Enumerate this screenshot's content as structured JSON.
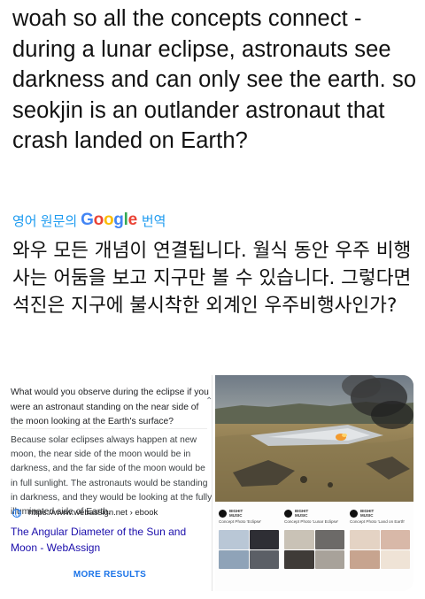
{
  "tweet": {
    "text": "woah so all the concepts connect - during a lunar eclipse, astronauts see darkness and can only see the earth. so seokjin is an outlander astronaut that crash landed on Earth?",
    "translate_prefix": "영어 원문의",
    "translate_google": "Google",
    "translate_suffix": "번역",
    "translated_text": "와우 모든 개념이 연결됩니다. 월식 동안 우주 비행사는 어둠을 보고 지구만 볼 수 있습니다. 그렇다면 석진은 지구에 불시착한 외계인 우주비행사인가?"
  },
  "search_card": {
    "question": "What would you observe during the eclipse if you were an astronaut standing on the near side of the moon looking at the Earth's surface?",
    "answer": "Because solar eclipses always happen at new moon, the near side of the moon would be in darkness, and the far side of the moon would be in full sunlight. The astronauts would be standing in darkness, and they would be looking at the fully illuminated side of Earth.",
    "source_url": "https://www.webassign.net › ebook",
    "source_title": "The Angular Diameter of the Sun and Moon - WebAssign",
    "more_results": "MORE RESULTS"
  },
  "mini_posts": [
    {
      "caption": "Concept Photo 'Eclipse'"
    },
    {
      "caption": "Concept Photo 'Lunar Eclipse'"
    },
    {
      "caption": "Concept Photo 'Land on Earth'"
    }
  ],
  "colors": {
    "link_blue": "#1d9bf0",
    "google_blue": "#4285f4",
    "google_red": "#ea4335",
    "google_yellow": "#fbbc05",
    "google_green": "#34a853",
    "search_link": "#1a0dab"
  }
}
